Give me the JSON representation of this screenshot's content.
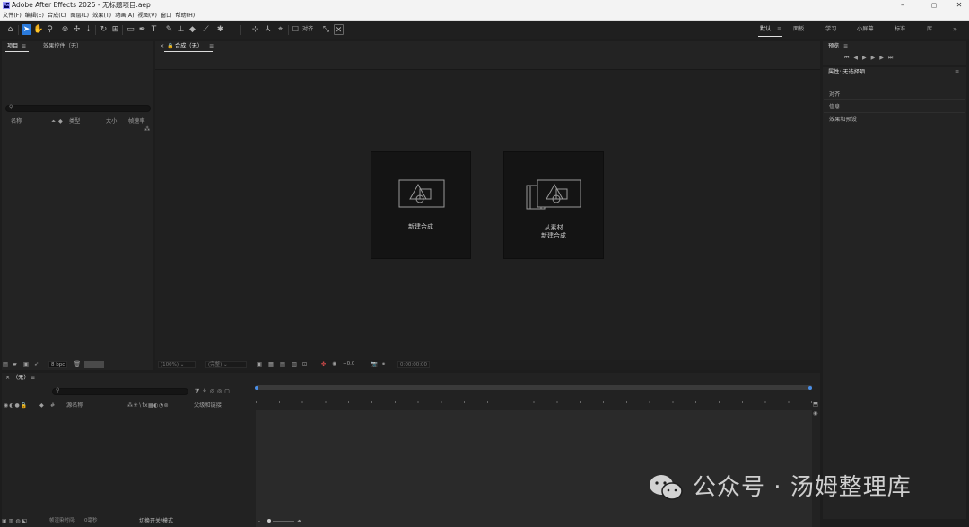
{
  "window": {
    "title": "Adobe After Effects 2025 - 无标题项目.aep",
    "icon_text": "Ae",
    "minimize": "–",
    "maximize": "▢",
    "close": "✕"
  },
  "menu": [
    "文件(F)",
    "编辑(E)",
    "合成(C)",
    "图层(L)",
    "效果(T)",
    "动画(A)",
    "视图(V)",
    "窗口",
    "帮助(H)"
  ],
  "toolbar": {
    "align_label": "对齐",
    "workspaces": [
      "默认",
      "面板",
      "学习",
      "小屏幕",
      "标准",
      "库"
    ],
    "overflow": "»"
  },
  "project_panel": {
    "tabs": [
      "项目",
      "效果控件（无）"
    ],
    "search_icon": "search-icon",
    "columns": [
      "名称",
      "类型",
      "大小",
      "帧速率"
    ],
    "bpc": "8 bpc"
  },
  "comp_panel": {
    "tab": "合成（无）",
    "new_comp": "新建合成",
    "from_footage_line1": "从素材",
    "from_footage_line2": "新建合成",
    "zoom": "(100%)",
    "resolution": "(完整)",
    "exposure": "+0.0",
    "timecode": "0:00:00:00"
  },
  "right_panel": {
    "preview_tab": "预览",
    "properties_tab": "属性: 无选择项",
    "sections": [
      "对齐",
      "信息",
      "效果和预设"
    ]
  },
  "timeline": {
    "tab": "（无）",
    "col_num": "#",
    "col_source": "源名称",
    "col_parent": "父级和链接",
    "footer_render": "帧渲染时间:",
    "footer_render_value": "0毫秒",
    "footer_toggle": "切换开关/模式"
  },
  "watermark": {
    "text": "公众号 · 汤姆整理库"
  }
}
